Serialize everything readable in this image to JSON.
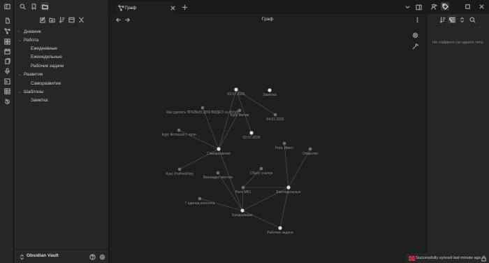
{
  "tabs": [
    {
      "label": "Граф",
      "icon": "graph-icon"
    }
  ],
  "view": {
    "title": "Граф"
  },
  "sidebar": {
    "tree": [
      {
        "label": "Дневник",
        "type": "folder",
        "expanded": false
      },
      {
        "label": "Работа",
        "type": "folder",
        "expanded": true
      },
      {
        "label": "Ежедневные",
        "type": "file"
      },
      {
        "label": "Еженедельные",
        "type": "file"
      },
      {
        "label": "Рабочие задачи",
        "type": "file"
      },
      {
        "label": "Развитие",
        "type": "folder",
        "expanded": true
      },
      {
        "label": "Саморазвитие",
        "type": "file"
      },
      {
        "label": "Шаблоны",
        "type": "folder",
        "expanded": true
      },
      {
        "label": "Заметка",
        "type": "file"
      }
    ],
    "vault_name": "Obsidian Vault"
  },
  "right_panel": {
    "empty_message": "Не найдено ни одного тега."
  },
  "status": {
    "sync_text": "Successfully synced last minute ago"
  },
  "colors": {
    "accent": "#8a5cf5",
    "error": "#e93147",
    "background": "#1e1e1e",
    "panel": "#262626",
    "node": "#dcdcdc",
    "node_dim": "#6f6f6f",
    "edge": "#4a4a4a"
  },
  "graph": {
    "nodes": [
      {
        "id": "d0307",
        "label": "03.07.2025",
        "primary": true
      },
      {
        "id": "zametka",
        "label": "Заметка",
        "primary": true
      },
      {
        "id": "preview",
        "label": "Как сделать ПРЕВЬЮ ДЛЯ ВИДЕО на ЮтуБ",
        "primary": false
      },
      {
        "id": "figma",
        "label": "Курс Фигма",
        "primary": false
      },
      {
        "id": "d0407",
        "label": "04.07.2025",
        "primary": false
      },
      {
        "id": "photoshop",
        "label": "Курс Фотошоп с нуля",
        "primary": false
      },
      {
        "id": "d0207",
        "label": "02.07.2025",
        "primary": true
      },
      {
        "id": "reels_ivest",
        "label": "Рилс Ивест",
        "primary": false
      },
      {
        "id": "otkrytki",
        "label": "Открытки",
        "primary": false
      },
      {
        "id": "samo",
        "label": "Саморазвитие",
        "primary": true
      },
      {
        "id": "premiere",
        "label": "Курс PrePeoPorp",
        "primary": false
      },
      {
        "id": "sources",
        "label": "Сбрес ссылок",
        "primary": false
      },
      {
        "id": "vykladka",
        "label": "Выкладка текстов",
        "primary": false
      },
      {
        "id": "reels_mk1",
        "label": "Рилс МК1",
        "primary": false
      },
      {
        "id": "weekly",
        "label": "Еженедельные",
        "primary": true
      },
      {
        "id": "units",
        "label": "7 единиц контента",
        "primary": false
      },
      {
        "id": "daily",
        "label": "Ежедневные",
        "primary": true
      },
      {
        "id": "work",
        "label": "Рабочие задачи",
        "primary": true
      }
    ],
    "edges": [
      [
        "d0307",
        "d0407"
      ],
      [
        "d0307",
        "d0207"
      ],
      [
        "d0307",
        "samo"
      ],
      [
        "preview",
        "samo"
      ],
      [
        "figma",
        "samo"
      ],
      [
        "photoshop",
        "samo"
      ],
      [
        "premiere",
        "samo"
      ],
      [
        "samo",
        "daily"
      ],
      [
        "vykladka",
        "daily"
      ],
      [
        "units",
        "daily"
      ],
      [
        "daily",
        "work"
      ],
      [
        "daily",
        "reels_mk1"
      ],
      [
        "reels_mk1",
        "weekly"
      ],
      [
        "sources",
        "reels_mk1"
      ],
      [
        "weekly",
        "reels_ivest"
      ],
      [
        "weekly",
        "otkrytki"
      ],
      [
        "weekly",
        "work"
      ],
      [
        "weekly",
        "daily"
      ]
    ]
  }
}
